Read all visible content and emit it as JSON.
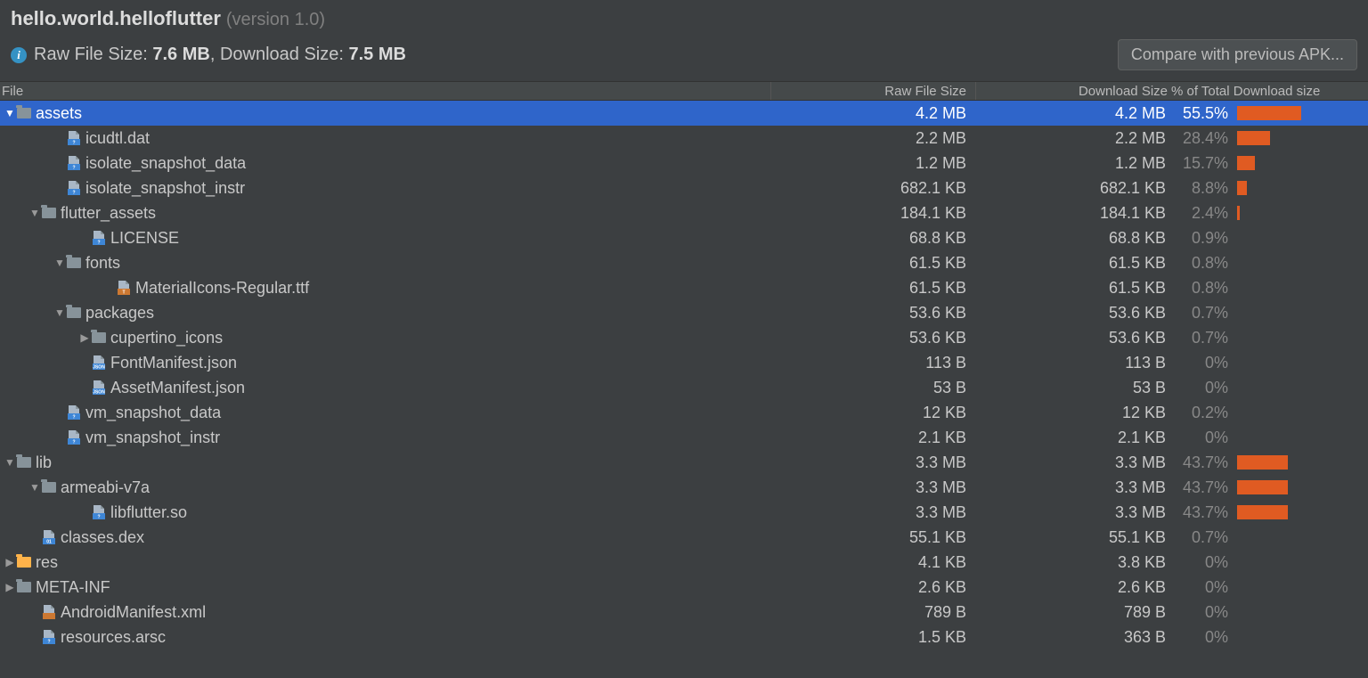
{
  "header": {
    "package": "hello.world.helloflutter",
    "version_label": "(version 1.0)",
    "info_prefix": "Raw File Size: ",
    "raw_size": "7.6 MB",
    "info_mid": ", Download Size: ",
    "dl_size": "7.5 MB",
    "compare_button": "Compare with previous APK..."
  },
  "columns": {
    "file": "File",
    "raw": "Raw File Size",
    "dl": "Download Size",
    "pct": "% of Total Download size"
  },
  "rows": [
    {
      "indent": 0,
      "arrow": "down",
      "icon": "folder",
      "name": "assets",
      "raw": "4.2 MB",
      "dl": "4.2 MB",
      "pct": "55.5%",
      "bar": 55.5,
      "selected": true
    },
    {
      "indent": 2,
      "arrow": "",
      "icon": "file",
      "name": "icudtl.dat",
      "raw": "2.2 MB",
      "dl": "2.2 MB",
      "pct": "28.4%",
      "bar": 28.4
    },
    {
      "indent": 2,
      "arrow": "",
      "icon": "file",
      "name": "isolate_snapshot_data",
      "raw": "1.2 MB",
      "dl": "1.2 MB",
      "pct": "15.7%",
      "bar": 15.7
    },
    {
      "indent": 2,
      "arrow": "",
      "icon": "file",
      "name": "isolate_snapshot_instr",
      "raw": "682.1 KB",
      "dl": "682.1 KB",
      "pct": "8.8%",
      "bar": 8.8
    },
    {
      "indent": 1,
      "arrow": "down",
      "icon": "folder",
      "name": "flutter_assets",
      "raw": "184.1 KB",
      "dl": "184.1 KB",
      "pct": "2.4%",
      "bar": 2.4
    },
    {
      "indent": 3,
      "arrow": "",
      "icon": "file",
      "name": "LICENSE",
      "raw": "68.8 KB",
      "dl": "68.8 KB",
      "pct": "0.9%",
      "bar": 0
    },
    {
      "indent": 2,
      "arrow": "down",
      "icon": "folder",
      "name": "fonts",
      "raw": "61.5 KB",
      "dl": "61.5 KB",
      "pct": "0.8%",
      "bar": 0
    },
    {
      "indent": 4,
      "arrow": "",
      "icon": "font",
      "name": "MaterialIcons-Regular.ttf",
      "raw": "61.5 KB",
      "dl": "61.5 KB",
      "pct": "0.8%",
      "bar": 0
    },
    {
      "indent": 2,
      "arrow": "down",
      "icon": "folder",
      "name": "packages",
      "raw": "53.6 KB",
      "dl": "53.6 KB",
      "pct": "0.7%",
      "bar": 0
    },
    {
      "indent": 3,
      "arrow": "right",
      "icon": "folder",
      "name": "cupertino_icons",
      "raw": "53.6 KB",
      "dl": "53.6 KB",
      "pct": "0.7%",
      "bar": 0
    },
    {
      "indent": 3,
      "arrow": "",
      "icon": "json",
      "name": "FontManifest.json",
      "raw": "113 B",
      "dl": "113 B",
      "pct": "0%",
      "bar": 0
    },
    {
      "indent": 3,
      "arrow": "",
      "icon": "json",
      "name": "AssetManifest.json",
      "raw": "53 B",
      "dl": "53 B",
      "pct": "0%",
      "bar": 0
    },
    {
      "indent": 2,
      "arrow": "",
      "icon": "file",
      "name": "vm_snapshot_data",
      "raw": "12 KB",
      "dl": "12 KB",
      "pct": "0.2%",
      "bar": 0
    },
    {
      "indent": 2,
      "arrow": "",
      "icon": "file",
      "name": "vm_snapshot_instr",
      "raw": "2.1 KB",
      "dl": "2.1 KB",
      "pct": "0%",
      "bar": 0
    },
    {
      "indent": 0,
      "arrow": "down",
      "icon": "folder",
      "name": "lib",
      "raw": "3.3 MB",
      "dl": "3.3 MB",
      "pct": "43.7%",
      "bar": 43.7
    },
    {
      "indent": 1,
      "arrow": "down",
      "icon": "folder",
      "name": "armeabi-v7a",
      "raw": "3.3 MB",
      "dl": "3.3 MB",
      "pct": "43.7%",
      "bar": 43.7
    },
    {
      "indent": 3,
      "arrow": "",
      "icon": "file",
      "name": "libflutter.so",
      "raw": "3.3 MB",
      "dl": "3.3 MB",
      "pct": "43.7%",
      "bar": 43.7
    },
    {
      "indent": 1,
      "arrow": "",
      "icon": "dex",
      "name": "classes.dex",
      "raw": "55.1 KB",
      "dl": "55.1 KB",
      "pct": "0.7%",
      "bar": 0
    },
    {
      "indent": 0,
      "arrow": "right",
      "icon": "folder-y",
      "name": "res",
      "raw": "4.1 KB",
      "dl": "3.8 KB",
      "pct": "0%",
      "bar": 0
    },
    {
      "indent": 0,
      "arrow": "right",
      "icon": "folder",
      "name": "META-INF",
      "raw": "2.6 KB",
      "dl": "2.6 KB",
      "pct": "0%",
      "bar": 0
    },
    {
      "indent": 1,
      "arrow": "",
      "icon": "xml",
      "name": "AndroidManifest.xml",
      "raw": "789 B",
      "dl": "789 B",
      "pct": "0%",
      "bar": 0
    },
    {
      "indent": 1,
      "arrow": "",
      "icon": "file",
      "name": "resources.arsc",
      "raw": "1.5 KB",
      "dl": "363 B",
      "pct": "0%",
      "bar": 0
    }
  ]
}
